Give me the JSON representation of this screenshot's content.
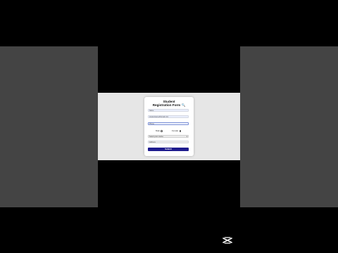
{
  "form": {
    "title_line1": "Student",
    "title_line2": "Registration Form",
    "title_emoji": "🔍",
    "name_value": "Name",
    "email_value": "studentname@gmail.com",
    "password_value": "Phone",
    "gender": {
      "male_label": "Male",
      "female_label": "Female"
    },
    "select_value": "Select your course",
    "extra_placeholder": "Address",
    "submit_label": "Submit"
  },
  "colors": {
    "submit_bg": "#1e1b8e",
    "card_bg": "#ffffff",
    "page_bg": "#e6e6e6",
    "side_panels": "#444444"
  },
  "overlay": {
    "logo_icon": "capcut-logo-icon"
  }
}
